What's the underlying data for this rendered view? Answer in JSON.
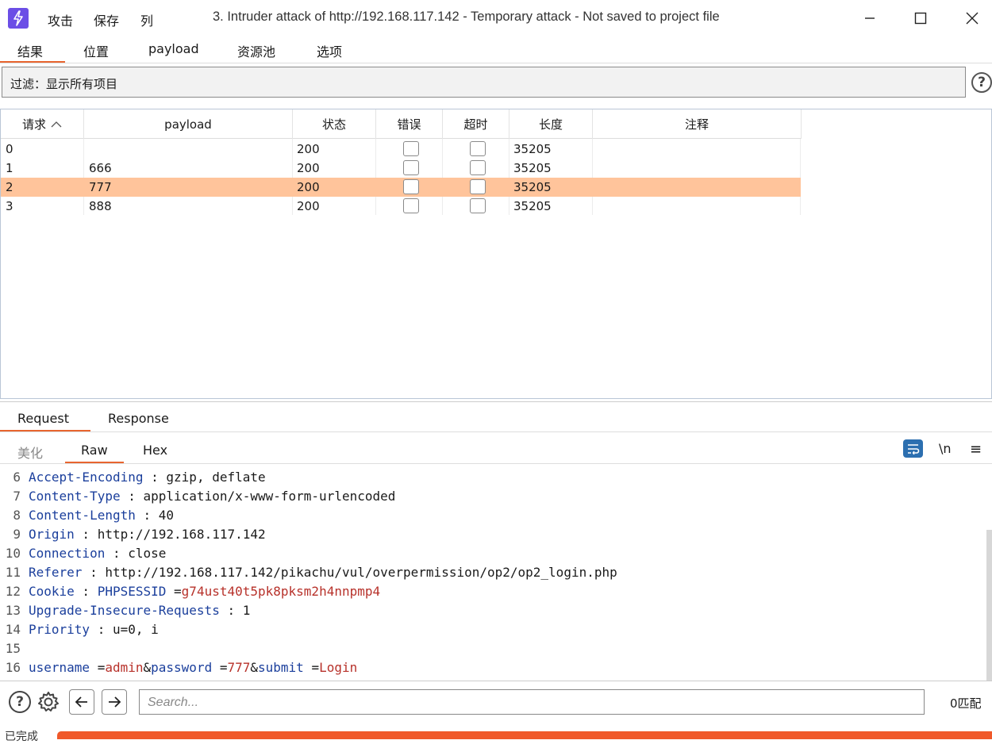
{
  "titlebar": {
    "menus": [
      "攻击",
      "保存",
      "列"
    ],
    "title": "3. Intruder attack of http://192.168.117.142 - Temporary attack - Not saved to project file"
  },
  "tabs": [
    "结果",
    "位置",
    "payload",
    "资源池",
    "选项"
  ],
  "filter": {
    "text": "过滤：显示所有项目",
    "help": "?"
  },
  "table": {
    "columns": [
      "请求",
      "payload",
      "状态",
      "错误",
      "超时",
      "长度",
      "注释"
    ],
    "sort_icon": "chevron-up-icon",
    "rows": [
      {
        "req": "0",
        "payload": "",
        "status": "200",
        "length": "35205",
        "selected": false
      },
      {
        "req": "1",
        "payload": "666",
        "status": "200",
        "length": "35205",
        "selected": false
      },
      {
        "req": "2",
        "payload": "777",
        "status": "200",
        "length": "35205",
        "selected": true
      },
      {
        "req": "3",
        "payload": "888",
        "status": "200",
        "length": "35205",
        "selected": false
      }
    ],
    "selected_color": "#ffc49b"
  },
  "message_tabs": [
    "Request",
    "Response"
  ],
  "view_tabs": [
    "美化",
    "Raw",
    "Hex"
  ],
  "view_icons": {
    "newline": "\\n",
    "menu": "≡"
  },
  "editor": {
    "lines": [
      {
        "n": "6",
        "name": "Accept-Encoding",
        "sep": " : ",
        "value": "gzip,  deflate"
      },
      {
        "n": "7",
        "name": "Content-Type",
        "sep": " : ",
        "value": "application/x-www-form-urlencoded"
      },
      {
        "n": "8",
        "name": "Content-Length",
        "sep": " : ",
        "value": "40"
      },
      {
        "n": "9",
        "name": "Origin",
        "sep": " :  ",
        "value": "http://192.168.117.142"
      },
      {
        "n": "10",
        "name": "Connection",
        "sep": " :  ",
        "value": "close"
      },
      {
        "n": "11",
        "name": "Referer",
        "sep": " :  ",
        "value": "http://192.168.117.142/pikachu/vul/overpermission/op2/op2_login.php"
      },
      {
        "n": "12",
        "name": "Cookie",
        "sep": " :  ",
        "value": ""
      },
      {
        "n": "13",
        "name": "Upgrade-Insecure-Requests",
        "sep": " : ",
        "value": "1"
      },
      {
        "n": "14",
        "name": "Priority",
        "sep": " :  ",
        "value": "u=0,  i"
      },
      {
        "n": "15",
        "name": "",
        "sep": "",
        "value": ""
      },
      {
        "n": "16",
        "name": "",
        "sep": "",
        "value": ""
      }
    ],
    "cookie": {
      "key": "PHPSESSID",
      "eq": " =",
      "val": "g74ust40t5pk8pksm2h4nnpmp4"
    },
    "body": {
      "k1": "username",
      "eq1": " =",
      "v1": "admin",
      "amp1": "&",
      "k2": "password",
      "eq2": " =",
      "v2": "777",
      "amp2": "&",
      "k3": "submit",
      "eq3": " =",
      "v3": "Login"
    }
  },
  "search": {
    "placeholder": "Search...",
    "matches": "0匹配"
  },
  "status": {
    "text": "已完成",
    "progress": 1.0
  }
}
